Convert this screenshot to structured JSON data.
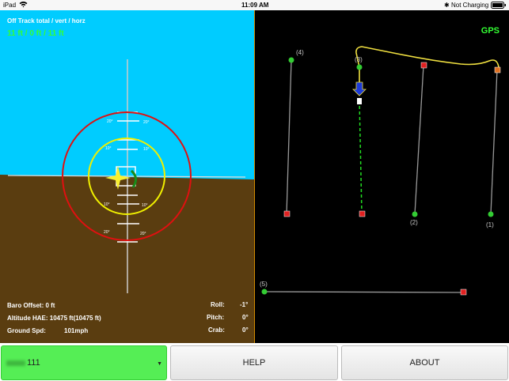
{
  "status_bar": {
    "device": "iPad",
    "time": "11:09 AM",
    "battery": "Not Charging"
  },
  "attitude": {
    "offtrack_label": "Off Track total / vert / horz",
    "offtrack_values": "11 ft / 0 ft / 11 ft",
    "pitch_ladder": {
      "upper_outer": "20°",
      "upper_inner": "10°",
      "lower_inner": "10°",
      "lower_outer": "20°"
    },
    "baro_offset": "Baro Offset: 0 ft",
    "altitude": "Altitude HAE: 10475 ft(10475 ft)",
    "ground_speed_label": "Ground Spd:",
    "ground_speed_value": "101mph",
    "roll_label": "Roll:",
    "roll_value": "-1°",
    "pitch_label": "Pitch:",
    "pitch_value": "0°",
    "crab_label": "Crab:",
    "crab_value": "0°",
    "colors": {
      "sky": "#00ccff",
      "ground": "#5a3d10",
      "outer_ring": "#e01010",
      "inner_ring": "#f0f000"
    }
  },
  "map": {
    "gps_label": "GPS",
    "waypoints": {
      "w1": "(1)",
      "w3": "(3)",
      "w4": "(4)",
      "w5": "(5)",
      "w2": "(2)"
    }
  },
  "bottom": {
    "device_suffix": "111",
    "help_label": "HELP",
    "about_label": "ABOUT"
  }
}
